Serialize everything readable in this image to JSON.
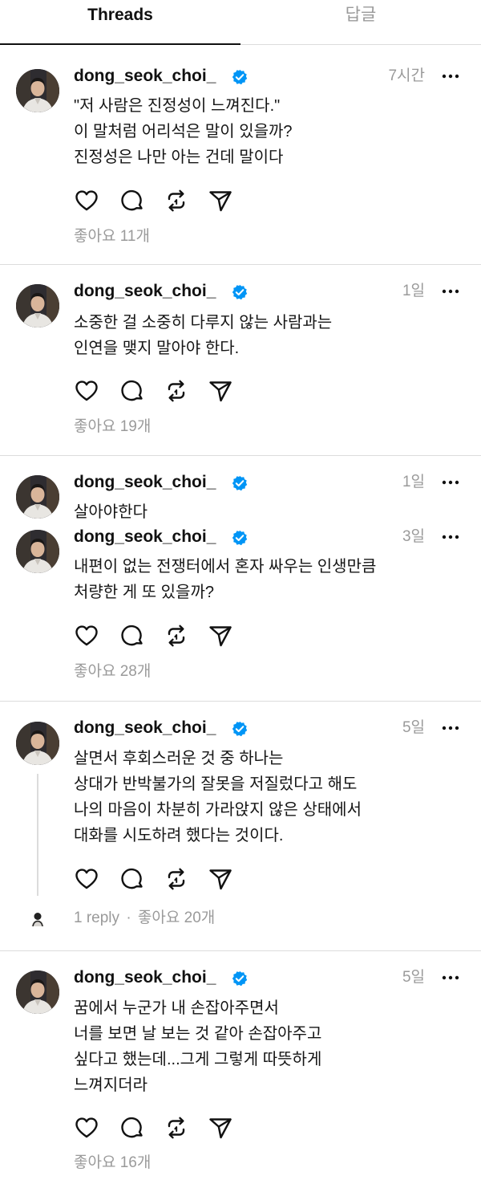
{
  "tabs": {
    "threads": "Threads",
    "replies": "답글"
  },
  "icons": {
    "verified": "verified-badge-icon",
    "more": "more-dots-icon",
    "like": "heart-icon",
    "reply": "comment-icon",
    "repost": "repost-icon",
    "share": "send-icon"
  },
  "colors": {
    "verified": "#0095f6",
    "muted": "#9a9a9a",
    "divider": "#dcdcdc"
  },
  "posts": [
    {
      "username": "dong_seok_choi_",
      "time": "7시간",
      "lines": [
        "\"저 사람은 진정성이 느껴진다.\"",
        "이 말처럼 어리석은 말이 있을까?",
        "진정성은 나만 아는 건데 말이다"
      ],
      "likes": "좋아요 11개"
    },
    {
      "username": "dong_seok_choi_",
      "time": "1일",
      "lines": [
        "소중한 걸 소중히 다루지 않는 사람과는",
        "인연을 맺지 말아야 한다."
      ],
      "likes": "좋아요 19개"
    },
    {
      "username": "dong_seok_choi_",
      "time": "1일",
      "lines": [
        "살아야한다"
      ]
    },
    {
      "username": "dong_seok_choi_",
      "time": "3일",
      "lines": [
        "내편이 없는 전쟁터에서 혼자 싸우는 인생만큼",
        "처량한 게 또 있을까?"
      ],
      "likes": "좋아요 28개"
    },
    {
      "username": "dong_seok_choi_",
      "time": "5일",
      "lines": [
        "살면서 후회스러운 것 중 하나는",
        "상대가 반박불가의 잘못을 저질렀다고 해도",
        "나의 마음이 차분히 가라앉지 않은 상태에서",
        "대화를 시도하려 했다는 것이다."
      ],
      "replies": "1 reply",
      "separator": "·",
      "likes": "좋아요 20개"
    },
    {
      "username": "dong_seok_choi_",
      "time": "5일",
      "lines": [
        "꿈에서 누군가 내 손잡아주면서",
        "너를 보면 날 보는 것 같아 손잡아주고",
        "싶다고 했는데...그게 그렇게 따뜻하게",
        "느껴지더라"
      ],
      "likes": "좋아요 16개"
    }
  ]
}
